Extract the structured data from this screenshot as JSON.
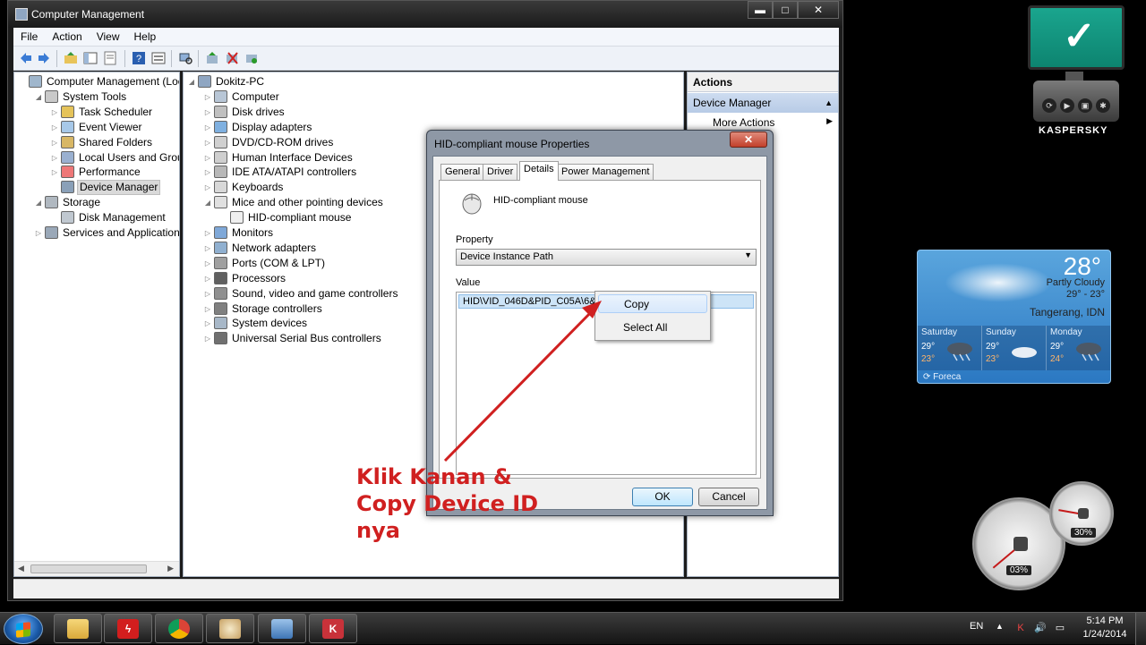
{
  "main_window": {
    "title": "Computer Management",
    "menu": [
      "File",
      "Action",
      "View",
      "Help"
    ],
    "caption": {
      "minimize": "▬",
      "maximize": "□",
      "close": "✕"
    }
  },
  "left_tree": {
    "items": [
      {
        "label": "Computer Management (Local",
        "level": 0,
        "arrow": "",
        "icon": "computer-management-icon"
      },
      {
        "label": "System Tools",
        "level": 1,
        "arrow": "◢",
        "icon": "system-tools-icon"
      },
      {
        "label": "Task Scheduler",
        "level": 2,
        "arrow": "▷",
        "icon": "clock-icon"
      },
      {
        "label": "Event Viewer",
        "level": 2,
        "arrow": "▷",
        "icon": "event-viewer-icon"
      },
      {
        "label": "Shared Folders",
        "level": 2,
        "arrow": "▷",
        "icon": "shared-folder-icon"
      },
      {
        "label": "Local Users and Groups",
        "level": 2,
        "arrow": "▷",
        "icon": "users-icon"
      },
      {
        "label": "Performance",
        "level": 2,
        "arrow": "▷",
        "icon": "performance-icon"
      },
      {
        "label": "Device Manager",
        "level": 2,
        "arrow": "",
        "icon": "device-manager-icon",
        "selected": true
      },
      {
        "label": "Storage",
        "level": 1,
        "arrow": "◢",
        "icon": "storage-icon"
      },
      {
        "label": "Disk Management",
        "level": 2,
        "arrow": "",
        "icon": "disk-icon"
      },
      {
        "label": "Services and Applications",
        "level": 1,
        "arrow": "▷",
        "icon": "services-icon"
      }
    ]
  },
  "device_tree": {
    "items": [
      {
        "label": "Dokitz-PC",
        "level": 0,
        "arrow": "◢",
        "icon": "pc-icon"
      },
      {
        "label": "Computer",
        "level": 1,
        "arrow": "▷",
        "icon": "computer-icon"
      },
      {
        "label": "Disk drives",
        "level": 1,
        "arrow": "▷",
        "icon": "disk-drive-icon"
      },
      {
        "label": "Display adapters",
        "level": 1,
        "arrow": "▷",
        "icon": "display-adapter-icon"
      },
      {
        "label": "DVD/CD-ROM drives",
        "level": 1,
        "arrow": "▷",
        "icon": "dvd-icon"
      },
      {
        "label": "Human Interface Devices",
        "level": 1,
        "arrow": "▷",
        "icon": "hid-icon"
      },
      {
        "label": "IDE ATA/ATAPI controllers",
        "level": 1,
        "arrow": "▷",
        "icon": "ide-icon"
      },
      {
        "label": "Keyboards",
        "level": 1,
        "arrow": "▷",
        "icon": "keyboard-icon"
      },
      {
        "label": "Mice and other pointing devices",
        "level": 1,
        "arrow": "◢",
        "icon": "mouse-icon"
      },
      {
        "label": "HID-compliant mouse",
        "level": 2,
        "arrow": "",
        "icon": "mouse-icon"
      },
      {
        "label": "Monitors",
        "level": 1,
        "arrow": "▷",
        "icon": "monitor-icon"
      },
      {
        "label": "Network adapters",
        "level": 1,
        "arrow": "▷",
        "icon": "network-icon"
      },
      {
        "label": "Ports (COM & LPT)",
        "level": 1,
        "arrow": "▷",
        "icon": "port-icon"
      },
      {
        "label": "Processors",
        "level": 1,
        "arrow": "▷",
        "icon": "processor-icon"
      },
      {
        "label": "Sound, video and game controllers",
        "level": 1,
        "arrow": "▷",
        "icon": "sound-icon"
      },
      {
        "label": "Storage controllers",
        "level": 1,
        "arrow": "▷",
        "icon": "storage-controller-icon"
      },
      {
        "label": "System devices",
        "level": 1,
        "arrow": "▷",
        "icon": "system-device-icon"
      },
      {
        "label": "Universal Serial Bus controllers",
        "level": 1,
        "arrow": "▷",
        "icon": "usb-icon"
      }
    ]
  },
  "actions": {
    "header": "Actions",
    "section": "Device Manager",
    "more": "More Actions"
  },
  "dialog": {
    "title": "HID-compliant mouse Properties",
    "close": "✕",
    "tabs": [
      "General",
      "Driver",
      "Details",
      "Power Management"
    ],
    "active_tab": "Details",
    "device_name": "HID-compliant mouse",
    "property_label": "Property",
    "property_value": "Device Instance Path",
    "value_label": "Value",
    "value_text": "HID\\VID_046D&PID_C05A\\6&5C8",
    "ok": "OK",
    "cancel": "Cancel"
  },
  "context_menu": {
    "items": [
      "Copy",
      "Select All"
    ]
  },
  "annotation": {
    "lines": [
      "Klik Kanan &",
      "Copy Device ID",
      "nya"
    ],
    "color": "#d02020"
  },
  "kaspersky": {
    "brand": "KASPERSKY",
    "check": "✓",
    "color": "#1aa58e"
  },
  "weather": {
    "temp": "28°",
    "condition": "Partly Cloudy",
    "range": "29° - 23°",
    "city": "Tangerang, IDN",
    "days": [
      {
        "name": "Saturday",
        "high": "29°",
        "low": "23°"
      },
      {
        "name": "Sunday",
        "high": "29°",
        "low": "23°"
      },
      {
        "name": "Monday",
        "high": "29°",
        "low": "24°"
      }
    ],
    "source": "Foreca"
  },
  "cpu_meter": {
    "cpu": "03%",
    "memory": "30%"
  },
  "taskbar": {
    "apps": [
      "windows-explorer-icon",
      "flash-icon",
      "chrome-icon",
      "paint-icon",
      "remote-desktop-icon",
      "kaspersky-icon"
    ],
    "language": "EN",
    "time": "5:14 PM",
    "date": "1/24/2014"
  }
}
